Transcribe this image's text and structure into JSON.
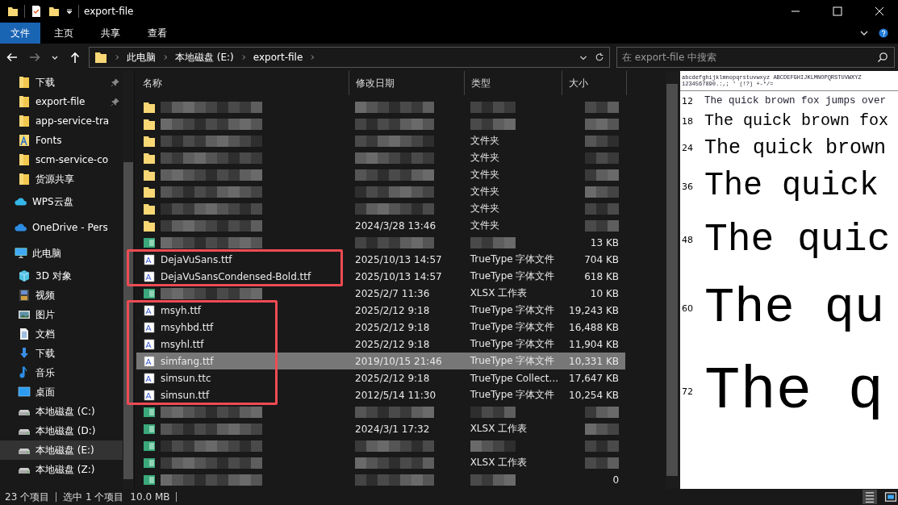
{
  "window": {
    "title": "export-file"
  },
  "ribbon_tabs": [
    {
      "label": "文件",
      "selected": true
    },
    {
      "label": "主页",
      "selected": false
    },
    {
      "label": "共享",
      "selected": false
    },
    {
      "label": "查看",
      "selected": false
    }
  ],
  "address": {
    "crumbs": [
      "此电脑",
      "本地磁盘 (E:)",
      "export-file"
    ]
  },
  "search": {
    "placeholder": "在 export-file 中搜索"
  },
  "nav": {
    "quick_access": [
      {
        "label": "下载",
        "kind": "folder",
        "pinned": true
      },
      {
        "label": "export-file",
        "kind": "folder",
        "pinned": true
      },
      {
        "label": "app-service-tra",
        "kind": "folder",
        "pinned": false
      },
      {
        "label": "Fonts",
        "kind": "font",
        "pinned": false
      },
      {
        "label": "scm-service-co",
        "kind": "folder",
        "pinned": false
      },
      {
        "label": "货源共享",
        "kind": "folder",
        "pinned": false
      }
    ],
    "clouds": [
      {
        "label": "WPS云盘",
        "kind": "cloud"
      },
      {
        "label": "OneDrive - Pers",
        "kind": "cloud"
      }
    ],
    "this_pc": {
      "label": "此电脑",
      "children": [
        {
          "label": "3D 对象",
          "kind": "cube",
          "selected": false
        },
        {
          "label": "视频",
          "kind": "video",
          "selected": false
        },
        {
          "label": "图片",
          "kind": "image",
          "selected": false
        },
        {
          "label": "文档",
          "kind": "document",
          "selected": false
        },
        {
          "label": "下载",
          "kind": "download",
          "selected": false
        },
        {
          "label": "音乐",
          "kind": "music",
          "selected": false
        },
        {
          "label": "桌面",
          "kind": "desktop",
          "selected": false
        },
        {
          "label": "本地磁盘 (C:)",
          "kind": "drive",
          "selected": false
        },
        {
          "label": "本地磁盘 (D:)",
          "kind": "drive",
          "selected": false
        },
        {
          "label": "本地磁盘 (E:)",
          "kind": "drive",
          "selected": true
        },
        {
          "label": "本地磁盘 (Z:)",
          "kind": "drive",
          "selected": false
        }
      ]
    }
  },
  "table": {
    "columns": [
      "名称",
      "修改日期",
      "类型",
      "大小"
    ],
    "row_groups": [
      {
        "kind": "plain",
        "rows": [
          {
            "kind": "folder",
            "selected": false
          },
          {
            "kind": "folder",
            "selected": false
          },
          {
            "kind": "folder",
            "type": "文件夹",
            "selected": false
          },
          {
            "kind": "folder",
            "type": "文件夹",
            "selected": false
          },
          {
            "kind": "folder",
            "type": "文件夹",
            "selected": false
          },
          {
            "kind": "folder",
            "type": "文件夹",
            "selected": false
          },
          {
            "kind": "folder",
            "type": "文件夹",
            "selected": false
          },
          {
            "kind": "folder",
            "date": "2024/3/28 13:46",
            "type": "文件夹",
            "selected": false
          },
          {
            "kind": "sheet",
            "size": "13 KB",
            "selected": false
          }
        ]
      },
      {
        "kind": "annotated",
        "rows": [
          {
            "kind": "font",
            "name": "DejaVuSans.ttf",
            "date": "2025/10/13 14:57",
            "type": "TrueType 字体文件",
            "size": "704 KB",
            "selected": false
          },
          {
            "kind": "font",
            "name": "DejaVuSansCondensed-Bold.ttf",
            "date": "2025/10/13 14:57",
            "type": "TrueType 字体文件",
            "size": "618 KB",
            "selected": false
          }
        ]
      },
      {
        "kind": "plain",
        "rows": [
          {
            "kind": "sheet",
            "date": "2025/2/7 11:36",
            "type": "XLSX 工作表",
            "size": "10 KB",
            "selected": false
          }
        ]
      },
      {
        "kind": "annotated",
        "rows": [
          {
            "kind": "font",
            "name": "msyh.ttf",
            "date": "2025/2/12 9:18",
            "type": "TrueType 字体文件",
            "size": "19,243 KB",
            "selected": false
          },
          {
            "kind": "font",
            "name": "msyhbd.ttf",
            "date": "2025/2/12 9:18",
            "type": "TrueType 字体文件",
            "size": "16,488 KB",
            "selected": false
          },
          {
            "kind": "font",
            "name": "msyhl.ttf",
            "date": "2025/2/12 9:18",
            "type": "TrueType 字体文件",
            "size": "11,904 KB",
            "selected": false
          },
          {
            "kind": "font",
            "name": "simfang.ttf",
            "date": "2019/10/15 21:46",
            "type": "TrueType 字体文件",
            "size": "10,331 KB",
            "selected": true
          },
          {
            "kind": "font",
            "name": "simsun.ttc",
            "date": "2025/2/12 9:18",
            "type": "TrueType Collect...",
            "size": "17,647 KB",
            "selected": false
          },
          {
            "kind": "font",
            "name": "simsun.ttf",
            "date": "2012/5/14 11:30",
            "type": "TrueType 字体文件",
            "size": "10,254 KB",
            "selected": false
          }
        ]
      },
      {
        "kind": "plain",
        "rows": [
          {
            "kind": "sheet",
            "selected": false
          },
          {
            "kind": "sheet",
            "date": "2024/3/1 17:32",
            "type": "XLSX 工作表",
            "selected": false
          },
          {
            "kind": "sheet",
            "selected": false
          },
          {
            "kind": "sheet",
            "type": "XLSX 工作表",
            "selected": false
          },
          {
            "kind": "sheet",
            "size": "0",
            "selected": false
          }
        ]
      }
    ]
  },
  "preview": {
    "charset": [
      "abcdefghijklmnopqrstuvwxyz ABCDEFGHIJKLMNOPQRSTUVWXYZ",
      "1234567890.:,; '  (!?) +-*/="
    ],
    "samples": [
      {
        "size": "12",
        "text": "The quick brown fox jumps over"
      },
      {
        "size": "18",
        "text": "The quick brown fox"
      },
      {
        "size": "24",
        "text": "The quick brown"
      },
      {
        "size": "36",
        "text": "The quick"
      },
      {
        "size": "48",
        "text": "The quic"
      },
      {
        "size": "60",
        "text": "The qu"
      },
      {
        "size": "72",
        "text": "The q"
      }
    ]
  },
  "status_bar": {
    "item_count": "23 个项目",
    "selection": "选中 1 个项目",
    "selection_size": "10.0 MB"
  }
}
